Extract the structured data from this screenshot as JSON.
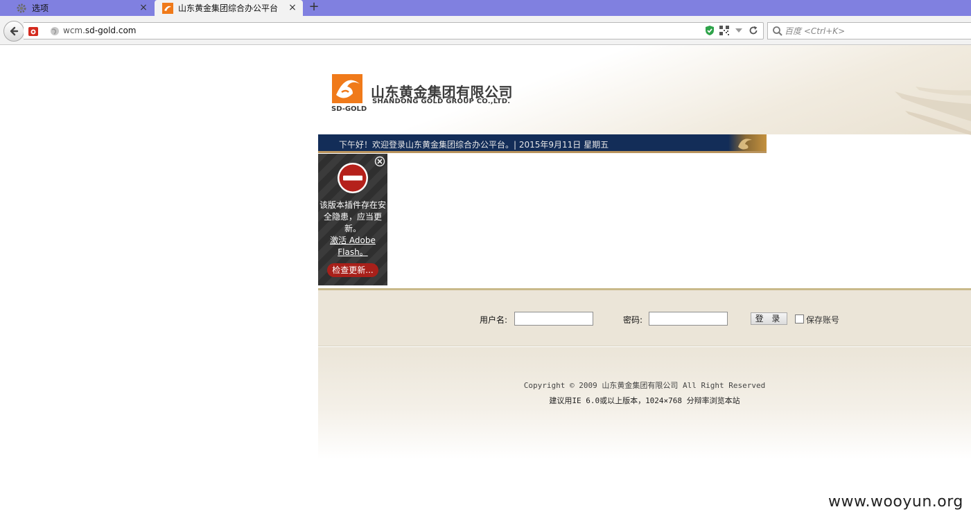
{
  "browser": {
    "tabs": [
      {
        "label": "选项",
        "icon": "gear-icon",
        "active": false
      },
      {
        "label": "山东黄金集团综合办公平台",
        "icon": "sd-gold-favicon",
        "active": true
      }
    ],
    "tab_close_glyph": "×",
    "new_tab_glyph": "+",
    "url_prefix": "wcm.",
    "url_domain": "sd-gold.com",
    "search_placeholder": "百度 <Ctrl+K>"
  },
  "header": {
    "logo_caption": "SD-GOLD",
    "brand_cn": "山东黄金集团有限公司",
    "brand_en": "SHANDONG GOLD GROUP CO.,LTD."
  },
  "welcome_bar": {
    "text": "下午好！欢迎登录山东黄金集团综合办公平台。| 2015年9月11日 星期五"
  },
  "flash_plugin": {
    "message": "该版本插件存在安全隐患，应当更新。",
    "activate_link": "激活 Adobe Flash。",
    "check_button": "检查更新..."
  },
  "login": {
    "username_label": "用户名:",
    "password_label": "密码:",
    "submit_label": "登 录",
    "remember_label": "保存账号",
    "username_value": "",
    "password_value": ""
  },
  "footer": {
    "copyright": "Copyright © 2009 山东黄金集团有限公司 All Right Reserved",
    "browser_tip": "建议用IE 6.0或以上版本，1024×768 分辩率浏览本站"
  },
  "watermark": "www.wooyun.org",
  "colors": {
    "tab_strip": "#8080e0",
    "welcome_bar": "#132d58",
    "brand_orange": "#f07a1a",
    "flash_button": "#a8201a"
  }
}
